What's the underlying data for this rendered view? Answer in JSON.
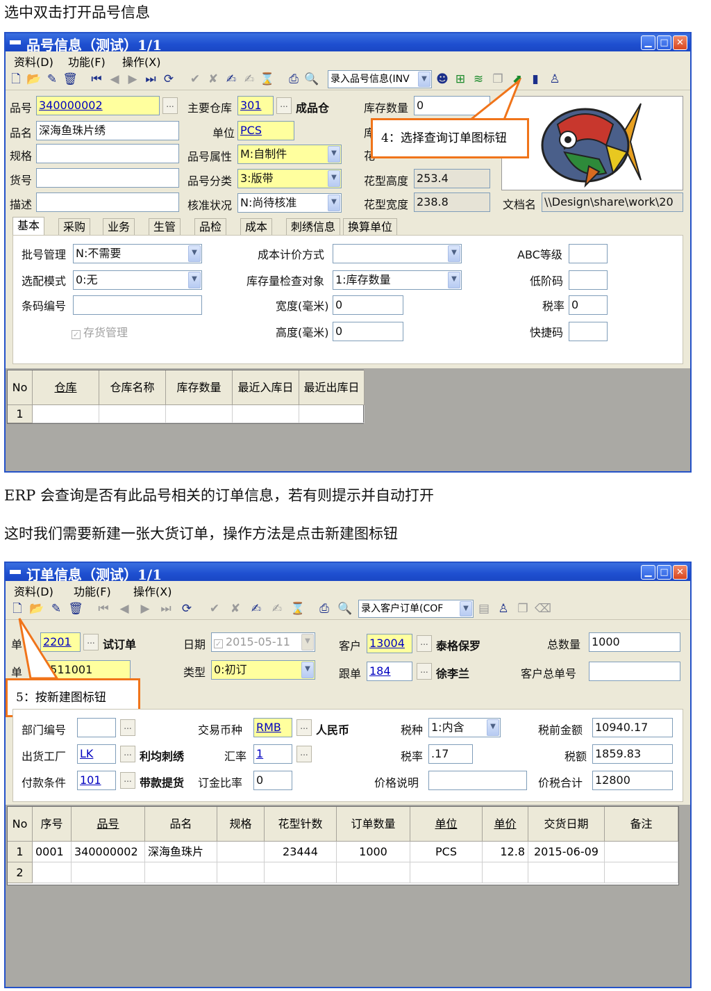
{
  "doc": {
    "line1": "选中双击打开品号信息",
    "line2": "ERP 会查询是否有此品号相关的订单信息，若有则提示并自动打开",
    "line3": "这时我们需要新建一张大货订单，操作方法是点击新建图标钮"
  },
  "win1": {
    "title": "品号信息（测试）1/1",
    "menu": [
      "资料(D)",
      "功能(F)",
      "操作(X)"
    ],
    "toolbar_select": "录入品号信息(INV",
    "callout": "4：选择查询订单图标钮",
    "fields": {
      "pinhao_lbl": "品号",
      "pinhao": "340000002",
      "pinming_lbl": "品名",
      "pinming": "深海鱼珠片绣",
      "guige_lbl": "规格",
      "guige": "",
      "huohao_lbl": "货号",
      "huohao": "",
      "miaoshu_lbl": "描述",
      "miaoshu": "",
      "cangku_lbl": "主要仓库",
      "cangku": "301",
      "cangku_name": "成品仓",
      "danwei_lbl": "单位",
      "danwei": "PCS",
      "shuxing_lbl": "品号属性",
      "shuxing": "M:自制件",
      "fenlei_lbl": "品号分类",
      "fenlei": "3:版带",
      "hezhun_lbl": "核准状况",
      "hezhun": "N:尚待核准",
      "kucun_lbl": "库存数量",
      "kucun": "0",
      "ku_partial": "库",
      "hua_partial": "花",
      "gaodu_lbl": "花型高度",
      "gaodu": "253.4",
      "kuandu_lbl": "花型宽度",
      "kuandu": "238.8",
      "wendang_lbl": "文档名",
      "wendang": "\\\\Design\\share\\work\\20"
    },
    "tabs": [
      "基本",
      "采购",
      "业务",
      "生管",
      "品检",
      "成本",
      "刺绣信息",
      "换算单位"
    ],
    "basic": {
      "pihao_lbl": "批号管理",
      "pihao": "N:不需要",
      "xuanpei_lbl": "选配模式",
      "xuanpei": "0:无",
      "tiaoma_lbl": "条码编号",
      "tiaoma": "",
      "cunhuo_lbl": "存货管理",
      "chengben_lbl": "成本计价方式",
      "chengben": "",
      "jiancha_lbl": "库存量检查对象",
      "jiancha": "1:库存数量",
      "kuan_lbl": "宽度(毫米)",
      "kuan": "0",
      "gao_lbl": "高度(毫米)",
      "gao": "0",
      "abc_lbl": "ABC等级",
      "abc": "",
      "dijie_lbl": "低阶码",
      "dijie": "",
      "shuilv_lbl": "税率",
      "shuilv": "0",
      "kuaijie_lbl": "快捷码",
      "kuaijie": ""
    },
    "grid": {
      "headers": [
        "No",
        "仓库",
        "仓库名称",
        "库存数量",
        "最近入库日",
        "最近出库日"
      ],
      "rows": [
        [
          "1",
          "",
          "",
          "",
          "",
          ""
        ]
      ]
    }
  },
  "win2": {
    "title": "订单信息（测试）1/1",
    "menu": [
      "资料(D)",
      "功能(F)",
      "操作(X)"
    ],
    "toolbar_select": "录入客户订单(COF",
    "callout": "5：按新建图标钮",
    "fields": {
      "dan1_lbl": "单",
      "dan1": "2201",
      "dan1_name": "试订单",
      "dan2_lbl": "单",
      "dan2": "0511001",
      "riqi_lbl": "日期",
      "riqi": "2015-05-11",
      "leixing_lbl": "类型",
      "leixing": "0:初订",
      "kehu_lbl": "客户",
      "kehu": "13004",
      "kehu_name": "泰格保罗",
      "gendan_lbl": "跟单",
      "gendan": "184",
      "gendan_name": "徐李兰",
      "zongshu_lbl": "总数量",
      "zongshu": "1000",
      "zongdan_lbl": "客户总单号",
      "zongdan": "",
      "bumen_lbl": "部门编号",
      "bumen": "",
      "gongchang_lbl": "出货工厂",
      "gongchang": "LK",
      "gongchang_name": "利均刺绣",
      "fukuan_lbl": "付款条件",
      "fukuan": "101",
      "fukuan_name": "带款提货",
      "bizhong_lbl": "交易币种",
      "bizhong": "RMB",
      "bizhong_name": "人民币",
      "huilv_lbl": "汇率",
      "huilv": "1",
      "dingjin_lbl": "订金比率",
      "dingjin": "0",
      "shuizhong_lbl": "税种",
      "shuizhong": "1:内含",
      "shuilv_lbl": "税率",
      "shuilv": ".17",
      "jiage_lbl": "价格说明",
      "jiage": "",
      "shuiqian_lbl": "税前金额",
      "shuiqian": "10940.17",
      "shuie_lbl": "税额",
      "shuie": "1859.83",
      "heji_lbl": "价税合计",
      "heji": "12800"
    },
    "grid": {
      "headers": [
        "No",
        "序号",
        "品号",
        "品名",
        "规格",
        "花型针数",
        "订单数量",
        "单位",
        "单价",
        "交货日期",
        "备注"
      ],
      "rows": [
        [
          "1",
          "0001",
          "340000002",
          "深海鱼珠片",
          "",
          "23444",
          "1000",
          "PCS",
          "12.8",
          "2015-06-09",
          ""
        ],
        [
          "2",
          "",
          "",
          "",
          "",
          "",
          "",
          "",
          "",
          "",
          ""
        ]
      ]
    }
  }
}
